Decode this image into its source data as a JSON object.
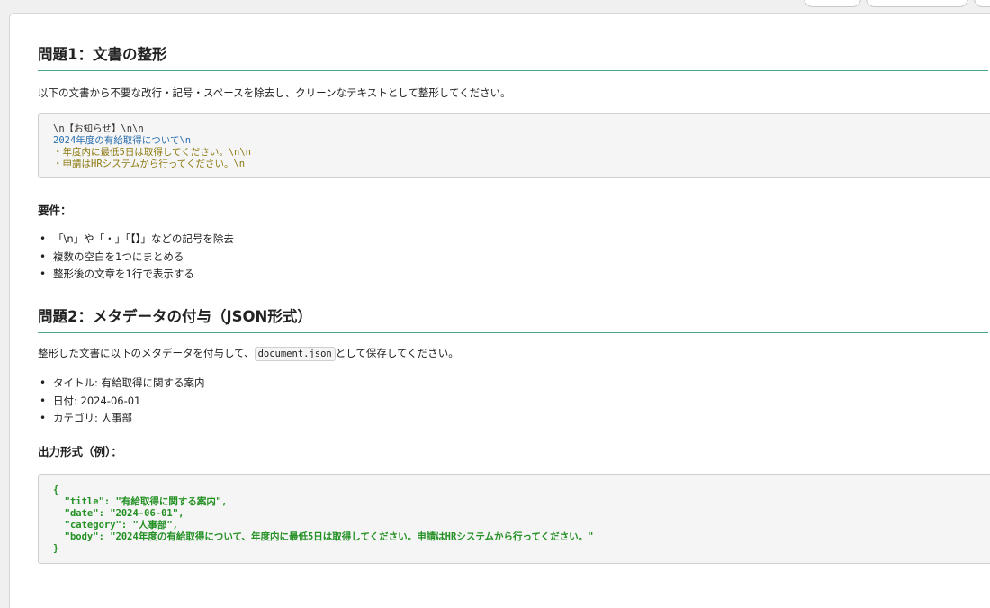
{
  "section1": {
    "heading": "問題1：文書の整形",
    "intro": "以下の文書から不要な改行・記号・スペースを除去し、クリーンなテキストとして整形してください。",
    "code_lines": [
      "\\n【お知らせ】\\n\\n",
      "2024年度の有給取得について\\n",
      "・年度内に最低5日は取得してください。\\n\\n",
      "・申請はHRシステムから行ってください。\\n"
    ],
    "requirements_label": "要件：",
    "requirements": [
      "「\\n」や「・」「【】」などの記号を除去",
      "複数の空白を1つにまとめる",
      "整形後の文章を1行で表示する"
    ]
  },
  "section2": {
    "heading": "問題2：メタデータの付与（JSON形式）",
    "intro_before": "整形した文書に以下のメタデータを付与して、",
    "intro_code": "document.json",
    "intro_after": "として保存してください。",
    "metadata": [
      "タイトル: 有給取得に関する案内",
      "日付: 2024-06-01",
      "カテゴリ: 人事部"
    ],
    "output_label": "出力形式（例）：",
    "json_lines": [
      "{",
      "  \"title\": \"有給取得に関する案内\",",
      "  \"date\": \"2024-06-01\",",
      "  \"category\": \"人事部\",",
      "  \"body\": \"2024年度の有給取得について、年度内に最低5日は取得してください。申請はHRシステムから行ってください。\"",
      "}"
    ]
  }
}
